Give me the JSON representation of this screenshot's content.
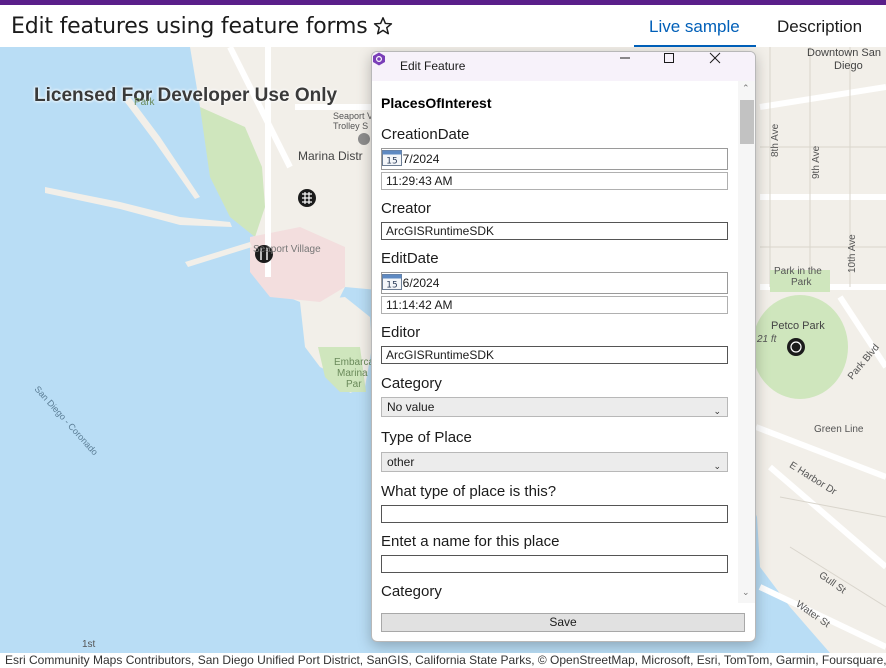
{
  "page": {
    "title": "Edit features using feature forms",
    "tabs": [
      {
        "label": "Live sample"
      },
      {
        "label": "Description"
      }
    ]
  },
  "map": {
    "license_text": "Licensed For Developer Use Only",
    "labels": {
      "downtown": "Downtown San Diego",
      "downtown_line1": "Downtown San",
      "downtown_line2": "Diego",
      "park": "Park",
      "seaport_trolley_line1": "Seaport V",
      "seaport_trolley_line2": "Trolley S",
      "marina": "Marina Distr",
      "seaport_village": "Seaport Village",
      "eighth_ave": "8th Ave",
      "ninth_ave": "9th Ave",
      "tenth_ave": "10th Ave",
      "park_in_park_line1": "Park in the",
      "park_in_park_line2": "Park",
      "petco_park": "Petco Park",
      "elevation": "21 ft",
      "park_blvd": "Park Blvd",
      "green_line": "Green Line",
      "embarcadero_line1": "Embarca",
      "embarcadero_line2": "Marina",
      "embarcadero_line3": "Par",
      "coronado": "San Diego - Coronado",
      "harbor": "E Harbor Dr",
      "gull": "Gull St",
      "water": "Water St",
      "bottom_left": "1st"
    },
    "attribution": "Esri Community Maps Contributors, San Diego Unified Port District, SanGIS, California State Parks, © OpenStreetMap, Microsoft, Esri, TomTom, Garmin, Foursquare, Safe"
  },
  "dialog": {
    "title": "Edit Feature",
    "layer_name": "PlacesOfInterest",
    "fields": {
      "creation_date_label": "CreationDate",
      "creation_date": "7/17/2024",
      "creation_time": "11:29:43 AM",
      "creator_label": "Creator",
      "creator": "ArcGISRuntimeSDK",
      "edit_date_label": "EditDate",
      "edit_date": "7/26/2024",
      "edit_time": "11:14:42 AM",
      "editor_label": "Editor",
      "editor": "ArcGISRuntimeSDK",
      "category_label": "Category",
      "category_value": "No value",
      "type_label": "Type of Place",
      "type_value": "other",
      "what_type_label": "What type of place is this?",
      "what_type_value": "",
      "name_label": "Entet a name for this place",
      "name_value": "",
      "category2_label": "Category"
    },
    "calendar_day": "15",
    "save_label": "Save"
  },
  "colors": {
    "accent": "#005fb8",
    "top_strip": "#5a1f8a",
    "water": "#b9ddf5",
    "land": "#f2efe9",
    "park": "#cfe6bd"
  }
}
